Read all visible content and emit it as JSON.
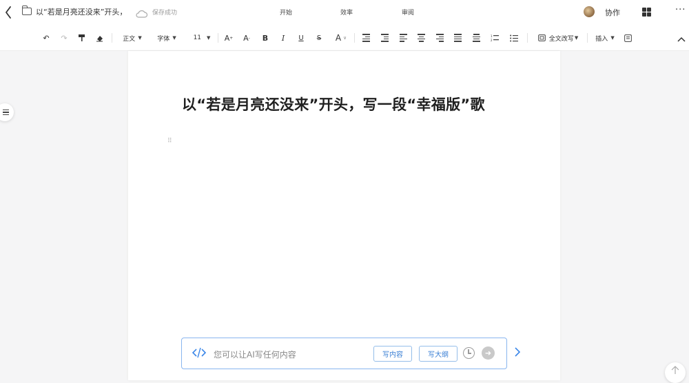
{
  "topbar": {
    "back_icon": "chevron-left-icon",
    "folder_icon": "folder-icon",
    "doc_title": "以“若是月亮还没来”开头，",
    "save_status": "保存成功",
    "tabs": [
      {
        "label": "开始"
      },
      {
        "label": "效率"
      },
      {
        "label": "审阅"
      }
    ],
    "collab_label": "协作",
    "more_label": "···"
  },
  "toolbar": {
    "undo": "↶",
    "redo": "↷",
    "style_label": "正文",
    "font_label": "字体",
    "size_label": "11",
    "bold": "B",
    "italic": "I",
    "underline": "U",
    "strike": "S",
    "font_color": "A",
    "increase_font": "A",
    "decrease_font": "A",
    "rewrite_label": "全文改写",
    "insert_label": "插入"
  },
  "document": {
    "heading": "以“若是月亮还没来”开头，写一段“幸福版”歌"
  },
  "ai_input": {
    "placeholder": "您可以让AI写任何内容",
    "write_content": "写内容",
    "write_outline": "写大纲",
    "accent_color": "#3a86e8"
  }
}
